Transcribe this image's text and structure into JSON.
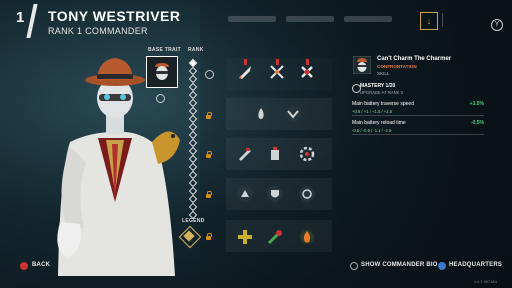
{
  "header": {
    "number": "1",
    "commander_name": "TONY WESTRIVER",
    "rank": "RANK 1 COMMANDER",
    "gamepad_button": "Y"
  },
  "grid": {
    "base_trait_label": "BASE TRAIT",
    "rank_label": "RANK",
    "legend_label": "LEGEND",
    "base_trait_mastery": 0.05
  },
  "skill_detail": {
    "title": "Can't Charm The Charmer",
    "type": "CONFRONTATION",
    "category": "SKILL",
    "mastery_label": "MASTERY 1/20",
    "mastery_sub": "UPGRADE AT RANK 3",
    "stats": [
      {
        "label": "Main battery traverse speed",
        "value": "+3.5%",
        "progression": "+0.5 / +1 / +1.5 / +2.5"
      },
      {
        "label": "Main battery reload time",
        "value": "-0.5%",
        "progression": "-0.5 / -0.9 / -1.1 / -2.5"
      }
    ]
  },
  "footer": {
    "back_label": "BACK",
    "bio_label": "SHOW COMMANDER BIO",
    "hq_label": "HEADQUARTERS",
    "version": "v.4.7.907184"
  },
  "colors": {
    "accent_orange": "#e87a4a",
    "positive_green": "#4ad17a",
    "lock_orange": "#d98a1c",
    "gold": "#d6b05a"
  }
}
